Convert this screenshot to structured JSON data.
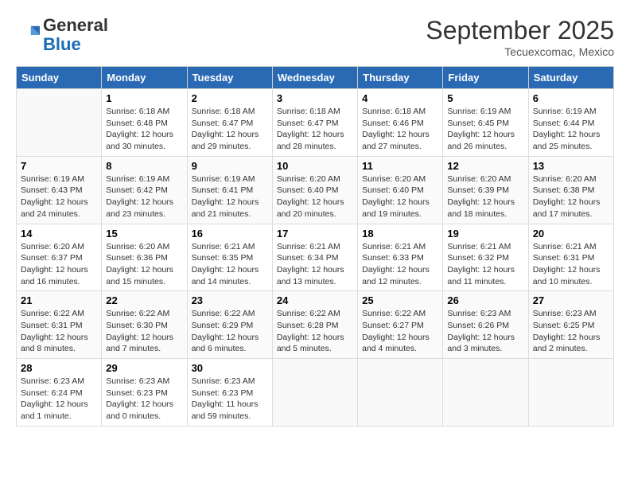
{
  "header": {
    "logo_general": "General",
    "logo_blue": "Blue",
    "month": "September 2025",
    "location": "Tecuexcomac, Mexico"
  },
  "days_of_week": [
    "Sunday",
    "Monday",
    "Tuesday",
    "Wednesday",
    "Thursday",
    "Friday",
    "Saturday"
  ],
  "weeks": [
    [
      {
        "day": "",
        "info": ""
      },
      {
        "day": "1",
        "info": "Sunrise: 6:18 AM\nSunset: 6:48 PM\nDaylight: 12 hours\nand 30 minutes."
      },
      {
        "day": "2",
        "info": "Sunrise: 6:18 AM\nSunset: 6:47 PM\nDaylight: 12 hours\nand 29 minutes."
      },
      {
        "day": "3",
        "info": "Sunrise: 6:18 AM\nSunset: 6:47 PM\nDaylight: 12 hours\nand 28 minutes."
      },
      {
        "day": "4",
        "info": "Sunrise: 6:18 AM\nSunset: 6:46 PM\nDaylight: 12 hours\nand 27 minutes."
      },
      {
        "day": "5",
        "info": "Sunrise: 6:19 AM\nSunset: 6:45 PM\nDaylight: 12 hours\nand 26 minutes."
      },
      {
        "day": "6",
        "info": "Sunrise: 6:19 AM\nSunset: 6:44 PM\nDaylight: 12 hours\nand 25 minutes."
      }
    ],
    [
      {
        "day": "7",
        "info": "Sunrise: 6:19 AM\nSunset: 6:43 PM\nDaylight: 12 hours\nand 24 minutes."
      },
      {
        "day": "8",
        "info": "Sunrise: 6:19 AM\nSunset: 6:42 PM\nDaylight: 12 hours\nand 23 minutes."
      },
      {
        "day": "9",
        "info": "Sunrise: 6:19 AM\nSunset: 6:41 PM\nDaylight: 12 hours\nand 21 minutes."
      },
      {
        "day": "10",
        "info": "Sunrise: 6:20 AM\nSunset: 6:40 PM\nDaylight: 12 hours\nand 20 minutes."
      },
      {
        "day": "11",
        "info": "Sunrise: 6:20 AM\nSunset: 6:40 PM\nDaylight: 12 hours\nand 19 minutes."
      },
      {
        "day": "12",
        "info": "Sunrise: 6:20 AM\nSunset: 6:39 PM\nDaylight: 12 hours\nand 18 minutes."
      },
      {
        "day": "13",
        "info": "Sunrise: 6:20 AM\nSunset: 6:38 PM\nDaylight: 12 hours\nand 17 minutes."
      }
    ],
    [
      {
        "day": "14",
        "info": "Sunrise: 6:20 AM\nSunset: 6:37 PM\nDaylight: 12 hours\nand 16 minutes."
      },
      {
        "day": "15",
        "info": "Sunrise: 6:20 AM\nSunset: 6:36 PM\nDaylight: 12 hours\nand 15 minutes."
      },
      {
        "day": "16",
        "info": "Sunrise: 6:21 AM\nSunset: 6:35 PM\nDaylight: 12 hours\nand 14 minutes."
      },
      {
        "day": "17",
        "info": "Sunrise: 6:21 AM\nSunset: 6:34 PM\nDaylight: 12 hours\nand 13 minutes."
      },
      {
        "day": "18",
        "info": "Sunrise: 6:21 AM\nSunset: 6:33 PM\nDaylight: 12 hours\nand 12 minutes."
      },
      {
        "day": "19",
        "info": "Sunrise: 6:21 AM\nSunset: 6:32 PM\nDaylight: 12 hours\nand 11 minutes."
      },
      {
        "day": "20",
        "info": "Sunrise: 6:21 AM\nSunset: 6:31 PM\nDaylight: 12 hours\nand 10 minutes."
      }
    ],
    [
      {
        "day": "21",
        "info": "Sunrise: 6:22 AM\nSunset: 6:31 PM\nDaylight: 12 hours\nand 8 minutes."
      },
      {
        "day": "22",
        "info": "Sunrise: 6:22 AM\nSunset: 6:30 PM\nDaylight: 12 hours\nand 7 minutes."
      },
      {
        "day": "23",
        "info": "Sunrise: 6:22 AM\nSunset: 6:29 PM\nDaylight: 12 hours\nand 6 minutes."
      },
      {
        "day": "24",
        "info": "Sunrise: 6:22 AM\nSunset: 6:28 PM\nDaylight: 12 hours\nand 5 minutes."
      },
      {
        "day": "25",
        "info": "Sunrise: 6:22 AM\nSunset: 6:27 PM\nDaylight: 12 hours\nand 4 minutes."
      },
      {
        "day": "26",
        "info": "Sunrise: 6:23 AM\nSunset: 6:26 PM\nDaylight: 12 hours\nand 3 minutes."
      },
      {
        "day": "27",
        "info": "Sunrise: 6:23 AM\nSunset: 6:25 PM\nDaylight: 12 hours\nand 2 minutes."
      }
    ],
    [
      {
        "day": "28",
        "info": "Sunrise: 6:23 AM\nSunset: 6:24 PM\nDaylight: 12 hours\nand 1 minute."
      },
      {
        "day": "29",
        "info": "Sunrise: 6:23 AM\nSunset: 6:23 PM\nDaylight: 12 hours\nand 0 minutes."
      },
      {
        "day": "30",
        "info": "Sunrise: 6:23 AM\nSunset: 6:23 PM\nDaylight: 11 hours\nand 59 minutes."
      },
      {
        "day": "",
        "info": ""
      },
      {
        "day": "",
        "info": ""
      },
      {
        "day": "",
        "info": ""
      },
      {
        "day": "",
        "info": ""
      }
    ]
  ]
}
